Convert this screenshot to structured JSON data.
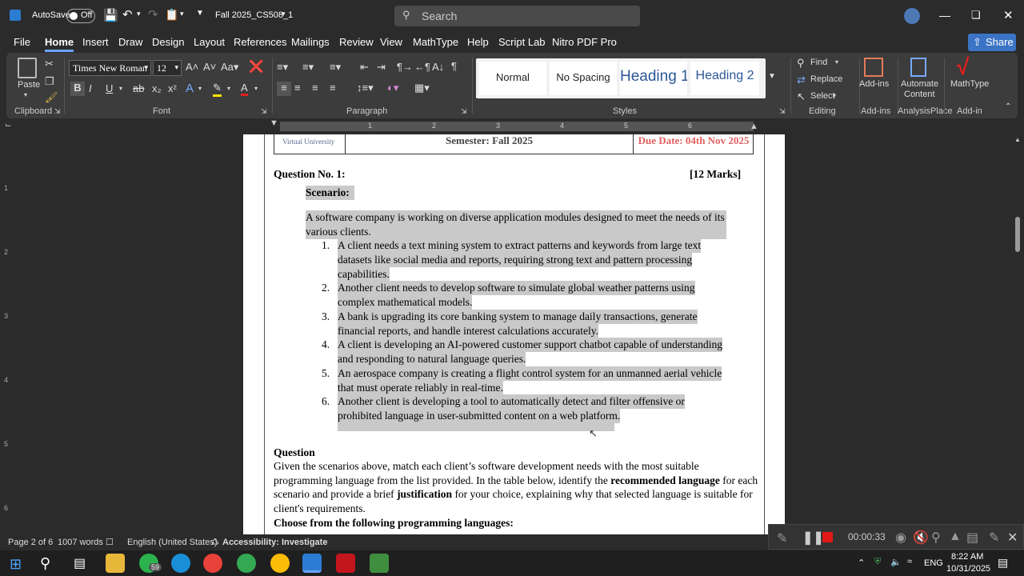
{
  "titlebar": {
    "autosave_label": "AutoSave",
    "autosave_state": "Off",
    "filename": "Fall 2025_CS508_1",
    "search_placeholder": "Search"
  },
  "menu": [
    "File",
    "Home",
    "Insert",
    "Draw",
    "Design",
    "Layout",
    "References",
    "Mailings",
    "Review",
    "View",
    "MathType",
    "Help",
    "Script Lab",
    "Nitro PDF Pro"
  ],
  "share_label": "Share",
  "ribbon": {
    "paste_label": "Paste",
    "clipboard_label": "Clipboard",
    "font_name": "Times New Roman",
    "font_size": "12",
    "font_label": "Font",
    "paragraph_label": "Paragraph",
    "styles": [
      "Normal",
      "No Spacing",
      "Heading 1",
      "Heading 2"
    ],
    "styles_label": "Styles",
    "find_label": "Find",
    "replace_label": "Replace",
    "select_label": "Select",
    "editing_label": "Editing",
    "addins_btn": "Add-ins",
    "addins_label": "Add-ins",
    "automate_btn1": "Automate",
    "automate_btn2": "Content",
    "analysis_label": "AnalysisPlace",
    "mathtype_btn": "MathType",
    "addin_label": "Add-in"
  },
  "ruler_numbers": [
    "1",
    "2",
    "3",
    "4",
    "5",
    "6"
  ],
  "vruler_numbers": [
    "1",
    "2",
    "3",
    "4",
    "5",
    "6"
  ],
  "document": {
    "header_logo_text": "Virtual University",
    "semester": "Semester: Fall 2025",
    "due_date": "Due Date: 04th Nov 2025",
    "question_no": "Question No. 1:",
    "marks": "[12 Marks]",
    "scenario_heading": "Scenario:",
    "intro": "A software company is working on diverse application modules designed to meet the needs of its various clients.",
    "items": [
      {
        "num": "1.",
        "lines": [
          "A client needs a text mining system to extract patterns and keywords from large text",
          "datasets like social media and reports, requiring strong text and pattern processing",
          "capabilities."
        ]
      },
      {
        "num": "2.",
        "lines": [
          "Another client needs to develop software to simulate global weather patterns using",
          "complex mathematical models."
        ]
      },
      {
        "num": "3.",
        "lines": [
          "A bank is upgrading its core banking system to manage daily transactions, generate",
          "financial reports, and handle interest calculations accurately."
        ]
      },
      {
        "num": "4.",
        "lines": [
          "A client is developing an AI-powered customer support chatbot capable of understanding",
          "and responding to natural language queries."
        ]
      },
      {
        "num": "5.",
        "lines": [
          "An aerospace company is creating a flight control system for an unmanned aerial vehicle",
          "that must operate reliably in real-time."
        ]
      },
      {
        "num": "6.",
        "lines": [
          "Another client is developing a tool to automatically detect and filter offensive or",
          "prohibited language in user-submitted content on a web platform."
        ]
      }
    ],
    "question_heading": "Question",
    "q_line1": "Given the scenarios above, match each client’s software development needs with the most suitable",
    "q_line2a": "programming language from the list provided. In the table below, identify the ",
    "q_line2b": "recommended language",
    "q_line2c": " for each",
    "q_line3a": "scenario and provide a brief ",
    "q_line3b": "justification",
    "q_line3c": " for your choice, explaining why that selected language is suitable for",
    "q_line4": "client's requirements.",
    "choose_heading": "Choose from the following programming languages:"
  },
  "status": {
    "page": "Page 2 of 6",
    "words": "1007 words",
    "language": "English (United States)",
    "accessibility": "Accessibility: Investigate"
  },
  "recording": {
    "time": "00:00:33"
  },
  "taskbar": {
    "badge": "59",
    "lang": "ENG",
    "time": "8:22 AM",
    "date": "10/31/2025"
  }
}
